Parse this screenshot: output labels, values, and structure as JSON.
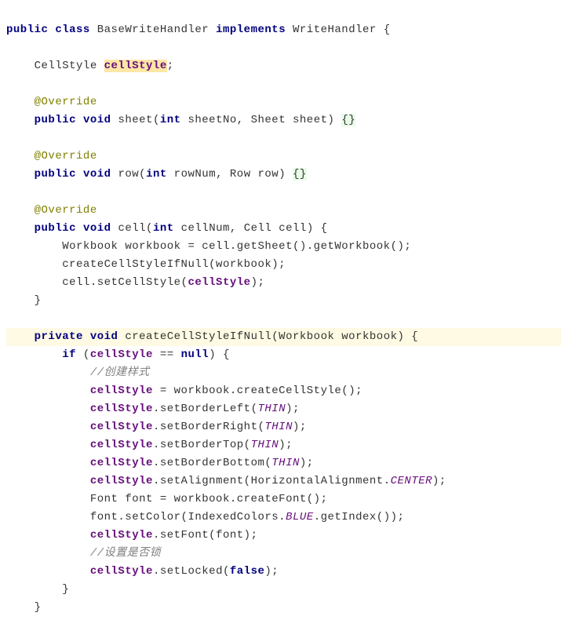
{
  "line1": {
    "public": "public",
    "class": "class",
    "name": "BaseWriteHandler",
    "implements": "implements",
    "iface": "WriteHandler",
    "brace": " {"
  },
  "line3": {
    "type": "CellStyle ",
    "field": "cellStyle",
    "semi": ";"
  },
  "line5": {
    "anno": "@Override"
  },
  "line6": {
    "public": "public",
    "void": "void",
    "name": " sheet(",
    "int": "int",
    "p1": " sheetNo, Sheet sheet) ",
    "braces": "{}"
  },
  "line8": {
    "anno": "@Override"
  },
  "line9": {
    "public": "public",
    "void": "void",
    "name": " row(",
    "int": "int",
    "p1": " rowNum, Row row) ",
    "braces": "{}"
  },
  "line11": {
    "anno": "@Override"
  },
  "line12": {
    "public": "public",
    "void": "void",
    "name": " cell(",
    "int": "int",
    "p1": " cellNum, Cell cell) {"
  },
  "line13": {
    "text": "Workbook workbook = cell.getSheet().getWorkbook();"
  },
  "line14": {
    "text": "createCellStyleIfNull(workbook);"
  },
  "line15": {
    "p1": "cell.setCellStyle(",
    "field": "cellStyle",
    "p2": ");"
  },
  "line16": {
    "brace": "}"
  },
  "line18": {
    "private": "private",
    "void": "void",
    "name": " createCellStyleIfNull(Workbook workbook) {"
  },
  "line19": {
    "if": "if",
    "p1": " (",
    "field": "cellStyle",
    "p2": " == ",
    "null": "null",
    "p3": ") {"
  },
  "line20": {
    "comment": "//创建样式"
  },
  "line21": {
    "field": "cellStyle",
    "text": " = workbook.createCellStyle();"
  },
  "line22": {
    "field": "cellStyle",
    "p1": ".setBorderLeft(",
    "thin": "THIN",
    "p2": ");"
  },
  "line23": {
    "field": "cellStyle",
    "p1": ".setBorderRight(",
    "thin": "THIN",
    "p2": ");"
  },
  "line24": {
    "field": "cellStyle",
    "p1": ".setBorderTop(",
    "thin": "THIN",
    "p2": ");"
  },
  "line25": {
    "field": "cellStyle",
    "p1": ".setBorderBottom(",
    "thin": "THIN",
    "p2": ");"
  },
  "line26": {
    "field": "cellStyle",
    "p1": ".setAlignment(HorizontalAlignment.",
    "center": "CENTER",
    "p2": ");"
  },
  "line27": {
    "text": "Font font = workbook.createFont();"
  },
  "line28": {
    "p1": "font.setColor(IndexedColors.",
    "blue": "BLUE",
    "p2": ".getIndex());"
  },
  "line29": {
    "field": "cellStyle",
    "text": ".setFont(font);"
  },
  "line30": {
    "comment": "//设置是否锁"
  },
  "line31": {
    "field": "cellStyle",
    "p1": ".setLocked(",
    "false": "false",
    "p2": ");"
  },
  "line32": {
    "brace": "}"
  },
  "line33": {
    "brace": "}"
  }
}
